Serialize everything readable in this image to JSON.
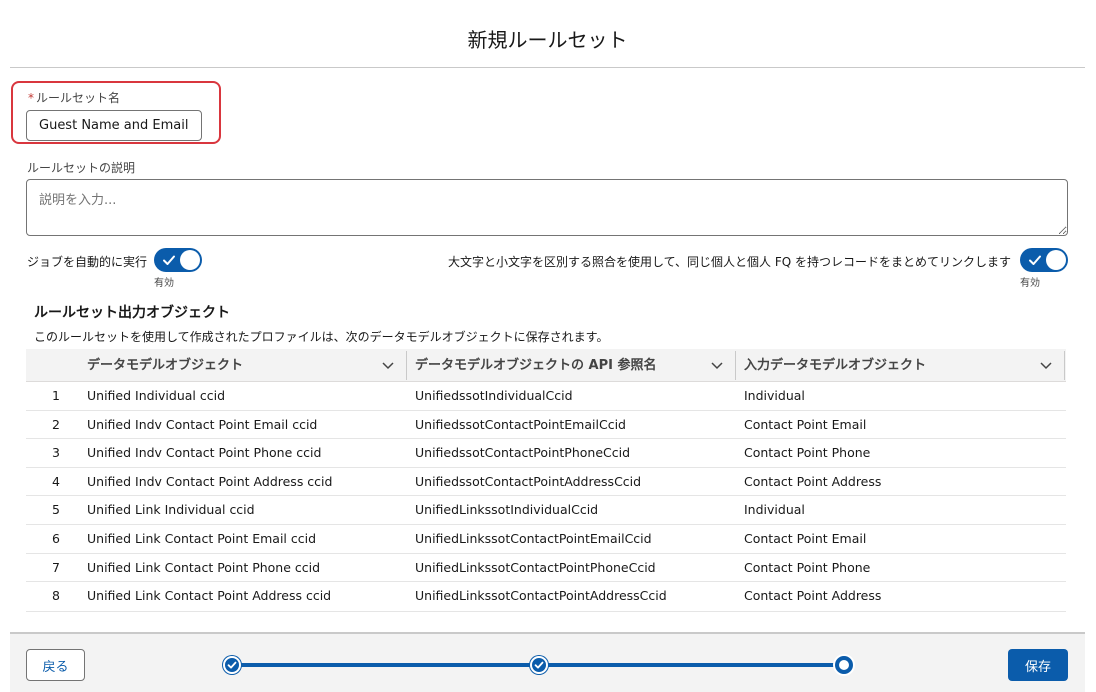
{
  "modal": {
    "title": "新規ルールセット"
  },
  "ruleset_name": {
    "label": "ルールセット名",
    "required_mark": "*",
    "value": "Guest Name and Email"
  },
  "description": {
    "label": "ルールセットの説明",
    "placeholder": "説明を入力..."
  },
  "toggles": {
    "auto_run": {
      "label": "ジョブを自動的に実行",
      "state": "有効",
      "on": true
    },
    "case_sensitive": {
      "label": "大文字と小文字を区別する照合を使用して、同じ個人と個人 FQ を持つレコードをまとめてリンクします",
      "state": "有効",
      "on": true
    }
  },
  "output_section": {
    "title": "ルールセット出力オブジェクト",
    "description": "このルールセットを使用して作成されたプロファイルは、次のデータモデルオブジェクトに保存されます。"
  },
  "table": {
    "columns": [
      {
        "label": "データモデルオブジェクト"
      },
      {
        "label": "データモデルオブジェクトの API 参照名"
      },
      {
        "label": "入力データモデルオブジェクト"
      }
    ],
    "rows": [
      {
        "num": "1",
        "dmo": "Unified Individual ccid",
        "api": "UnifiedssotIndividualCcid",
        "input": "Individual"
      },
      {
        "num": "2",
        "dmo": "Unified Indv Contact Point Email ccid",
        "api": "UnifiedssotContactPointEmailCcid",
        "input": "Contact Point Email"
      },
      {
        "num": "3",
        "dmo": "Unified Indv Contact Point Phone ccid",
        "api": "UnifiedssotContactPointPhoneCcid",
        "input": "Contact Point Phone"
      },
      {
        "num": "4",
        "dmo": "Unified Indv Contact Point Address ccid",
        "api": "UnifiedssotContactPointAddressCcid",
        "input": "Contact Point Address"
      },
      {
        "num": "5",
        "dmo": "Unified Link Individual ccid",
        "api": "UnifiedLinkssotIndividualCcid",
        "input": "Individual"
      },
      {
        "num": "6",
        "dmo": "Unified Link Contact Point Email ccid",
        "api": "UnifiedLinkssotContactPointEmailCcid",
        "input": "Contact Point Email"
      },
      {
        "num": "7",
        "dmo": "Unified Link Contact Point Phone ccid",
        "api": "UnifiedLinkssotContactPointPhoneCcid",
        "input": "Contact Point Phone"
      },
      {
        "num": "8",
        "dmo": "Unified Link Contact Point Address ccid",
        "api": "UnifiedLinkssotContactPointAddressCcid",
        "input": "Contact Point Address"
      }
    ]
  },
  "footer": {
    "back_label": "戻る",
    "save_label": "保存",
    "progress": {
      "total_steps": 3,
      "current_step": 3
    }
  },
  "colors": {
    "brand": "#0b5cab",
    "error_border": "#d9363e"
  }
}
